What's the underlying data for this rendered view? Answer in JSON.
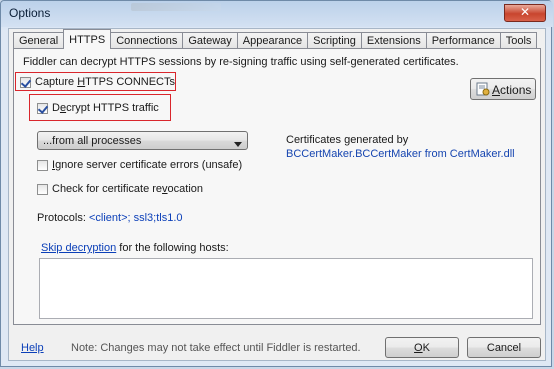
{
  "window": {
    "title": "Options",
    "close_glyph": "✕"
  },
  "tabs": [
    {
      "label": "General"
    },
    {
      "label": "HTTPS"
    },
    {
      "label": "Connections"
    },
    {
      "label": "Gateway"
    },
    {
      "label": "Appearance"
    },
    {
      "label": "Scripting"
    },
    {
      "label": "Extensions"
    },
    {
      "label": "Performance"
    },
    {
      "label": "Tools"
    }
  ],
  "active_tab": "HTTPS",
  "https": {
    "description": "Fiddler can decrypt HTTPS sessions by re-signing traffic using self-generated certificates.",
    "capture": {
      "label_pre": "Capture ",
      "label_accel": "H",
      "label_post": "TTPS CONNECTs",
      "checked": true
    },
    "decrypt": {
      "label_pre": "D",
      "label_accel": "e",
      "label_post": "crypt HTTPS traffic",
      "checked": true
    },
    "process_filter": {
      "selected": "...from all processes"
    },
    "ignore_errors": {
      "label_pre": "",
      "label_accel": "I",
      "label_post": "gnore server certificate errors (unsafe)",
      "checked": false
    },
    "check_revocation": {
      "label_pre": "Check for certificate re",
      "label_accel": "v",
      "label_post": "ocation",
      "checked": false
    },
    "actions_button": {
      "label_accel": "A",
      "label_post": "ctions"
    },
    "cert_info": {
      "label": "Certificates generated by",
      "value": "BCCertMaker.BCCertMaker from CertMaker.dll"
    },
    "protocols": {
      "label": "Protocols: ",
      "value": "<client>; ssl3;tls1.0"
    },
    "skip": {
      "link": "Skip decryption",
      "post": " for the following hosts:"
    },
    "hosts_value": ""
  },
  "footer": {
    "help": "Help",
    "note": "Note: Changes may not take effect until Fiddler is restarted.",
    "ok_accel": "O",
    "ok_post": "K",
    "cancel": "Cancel"
  },
  "colors": {
    "highlight_box": "#d9262c",
    "link": "#0b3fb8"
  }
}
